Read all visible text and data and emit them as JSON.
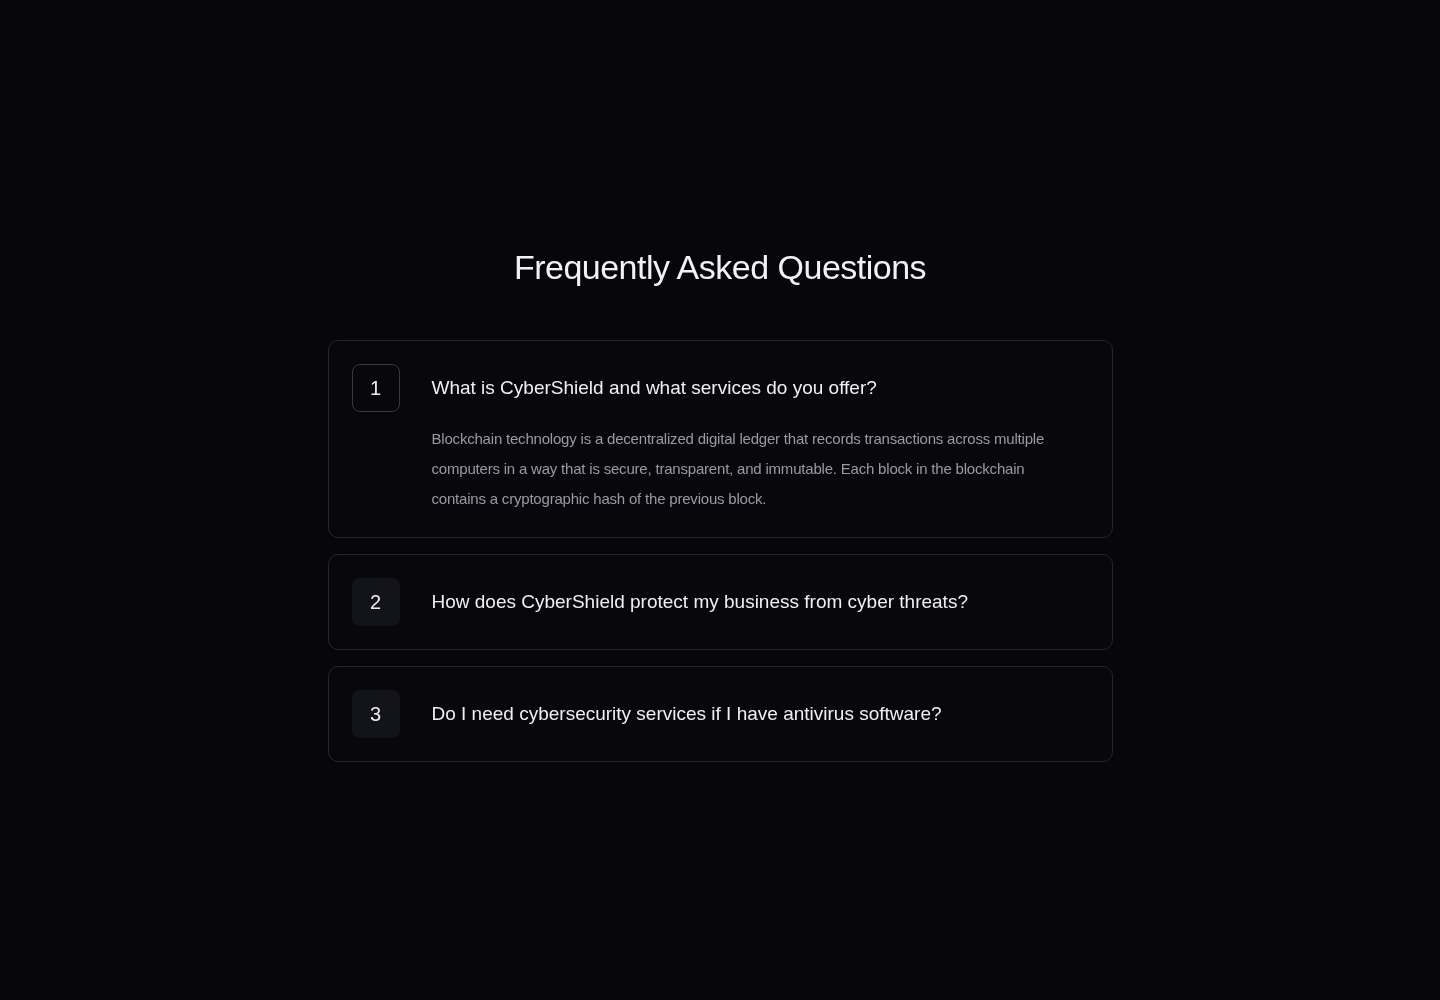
{
  "heading": "Frequently Asked Questions",
  "faqs": [
    {
      "number": "1",
      "question": "What is CyberShield and what services do you offer?",
      "expanded": true,
      "answer": "Blockchain technology is a decentralized digital ledger that records transactions across multiple computers in a way that is secure, transparent, and immutable. Each block in the blockchain contains a cryptographic hash of the previous block."
    },
    {
      "number": "2",
      "question": "How does CyberShield protect my business from cyber threats?",
      "expanded": false
    },
    {
      "number": "3",
      "question": "Do I need cybersecurity services if I have antivirus software?",
      "expanded": false
    }
  ]
}
